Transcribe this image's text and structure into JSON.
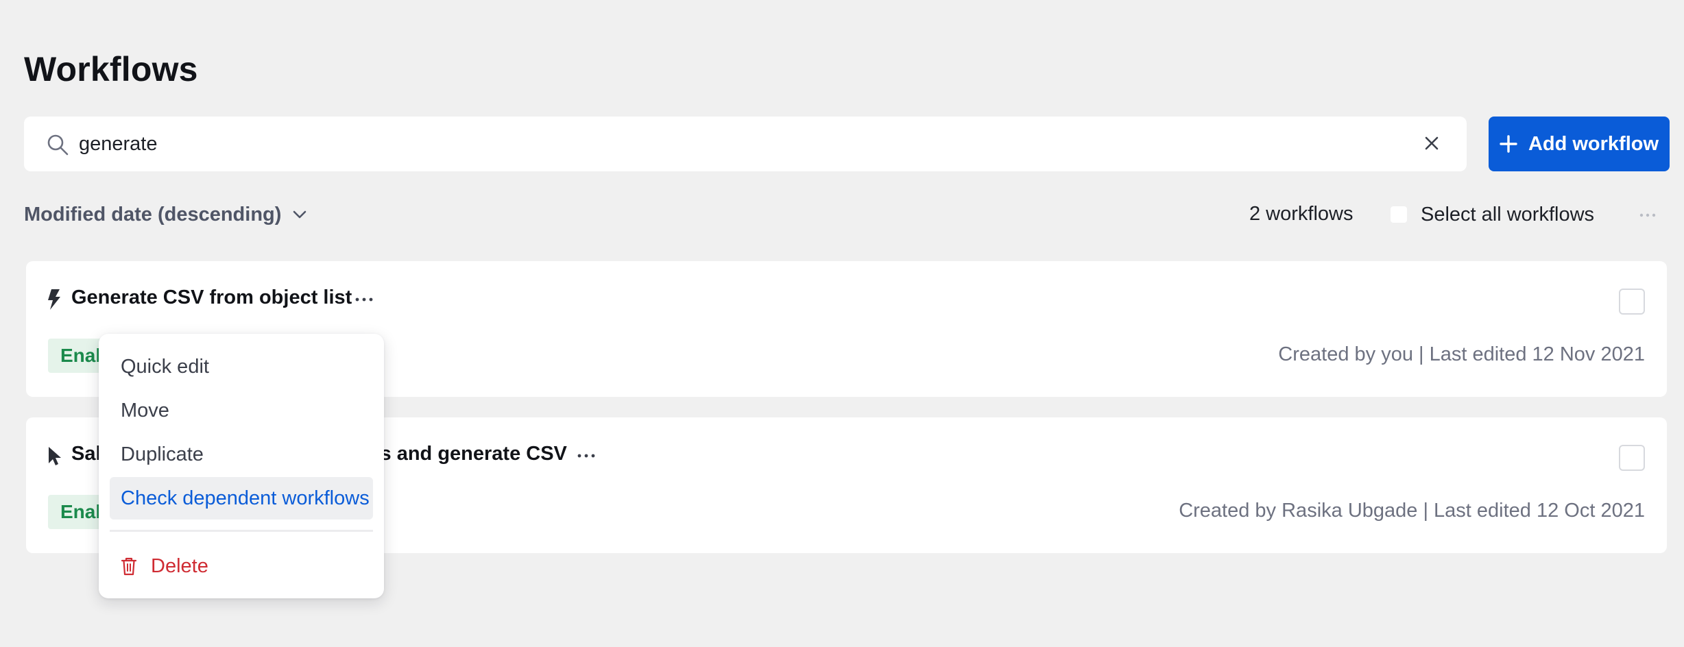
{
  "page": {
    "title": "Workflows"
  },
  "search": {
    "value": "generate",
    "icon": "search-icon",
    "clear_icon": "close-icon"
  },
  "toolbar": {
    "add_label": "Add workflow",
    "add_icon": "plus-icon",
    "accent_color": "#0a5cd8"
  },
  "filters": {
    "sort_label": "Modified date (descending)",
    "count_text": "2 workflows",
    "select_all_label": "Select all workflows"
  },
  "workflows": [
    {
      "icon": "lightning-bolt-icon",
      "title": "Generate CSV from object list",
      "status": "Enab",
      "meta": "Created by you | Last edited 12 Nov 2021"
    },
    {
      "icon": "cursor-pointer-icon",
      "title_left": "Sal",
      "title_right": "s and generate CSV",
      "status": "Enab",
      "meta": "Created by Rasika Ubgade | Last edited 12 Oct 2021"
    }
  ],
  "menu": {
    "items": [
      {
        "label": "Quick edit"
      },
      {
        "label": "Move"
      },
      {
        "label": "Duplicate"
      },
      {
        "label": "Check dependent workflows",
        "highlighted": true
      }
    ],
    "delete_label": "Delete",
    "delete_color": "#cf2b32"
  }
}
